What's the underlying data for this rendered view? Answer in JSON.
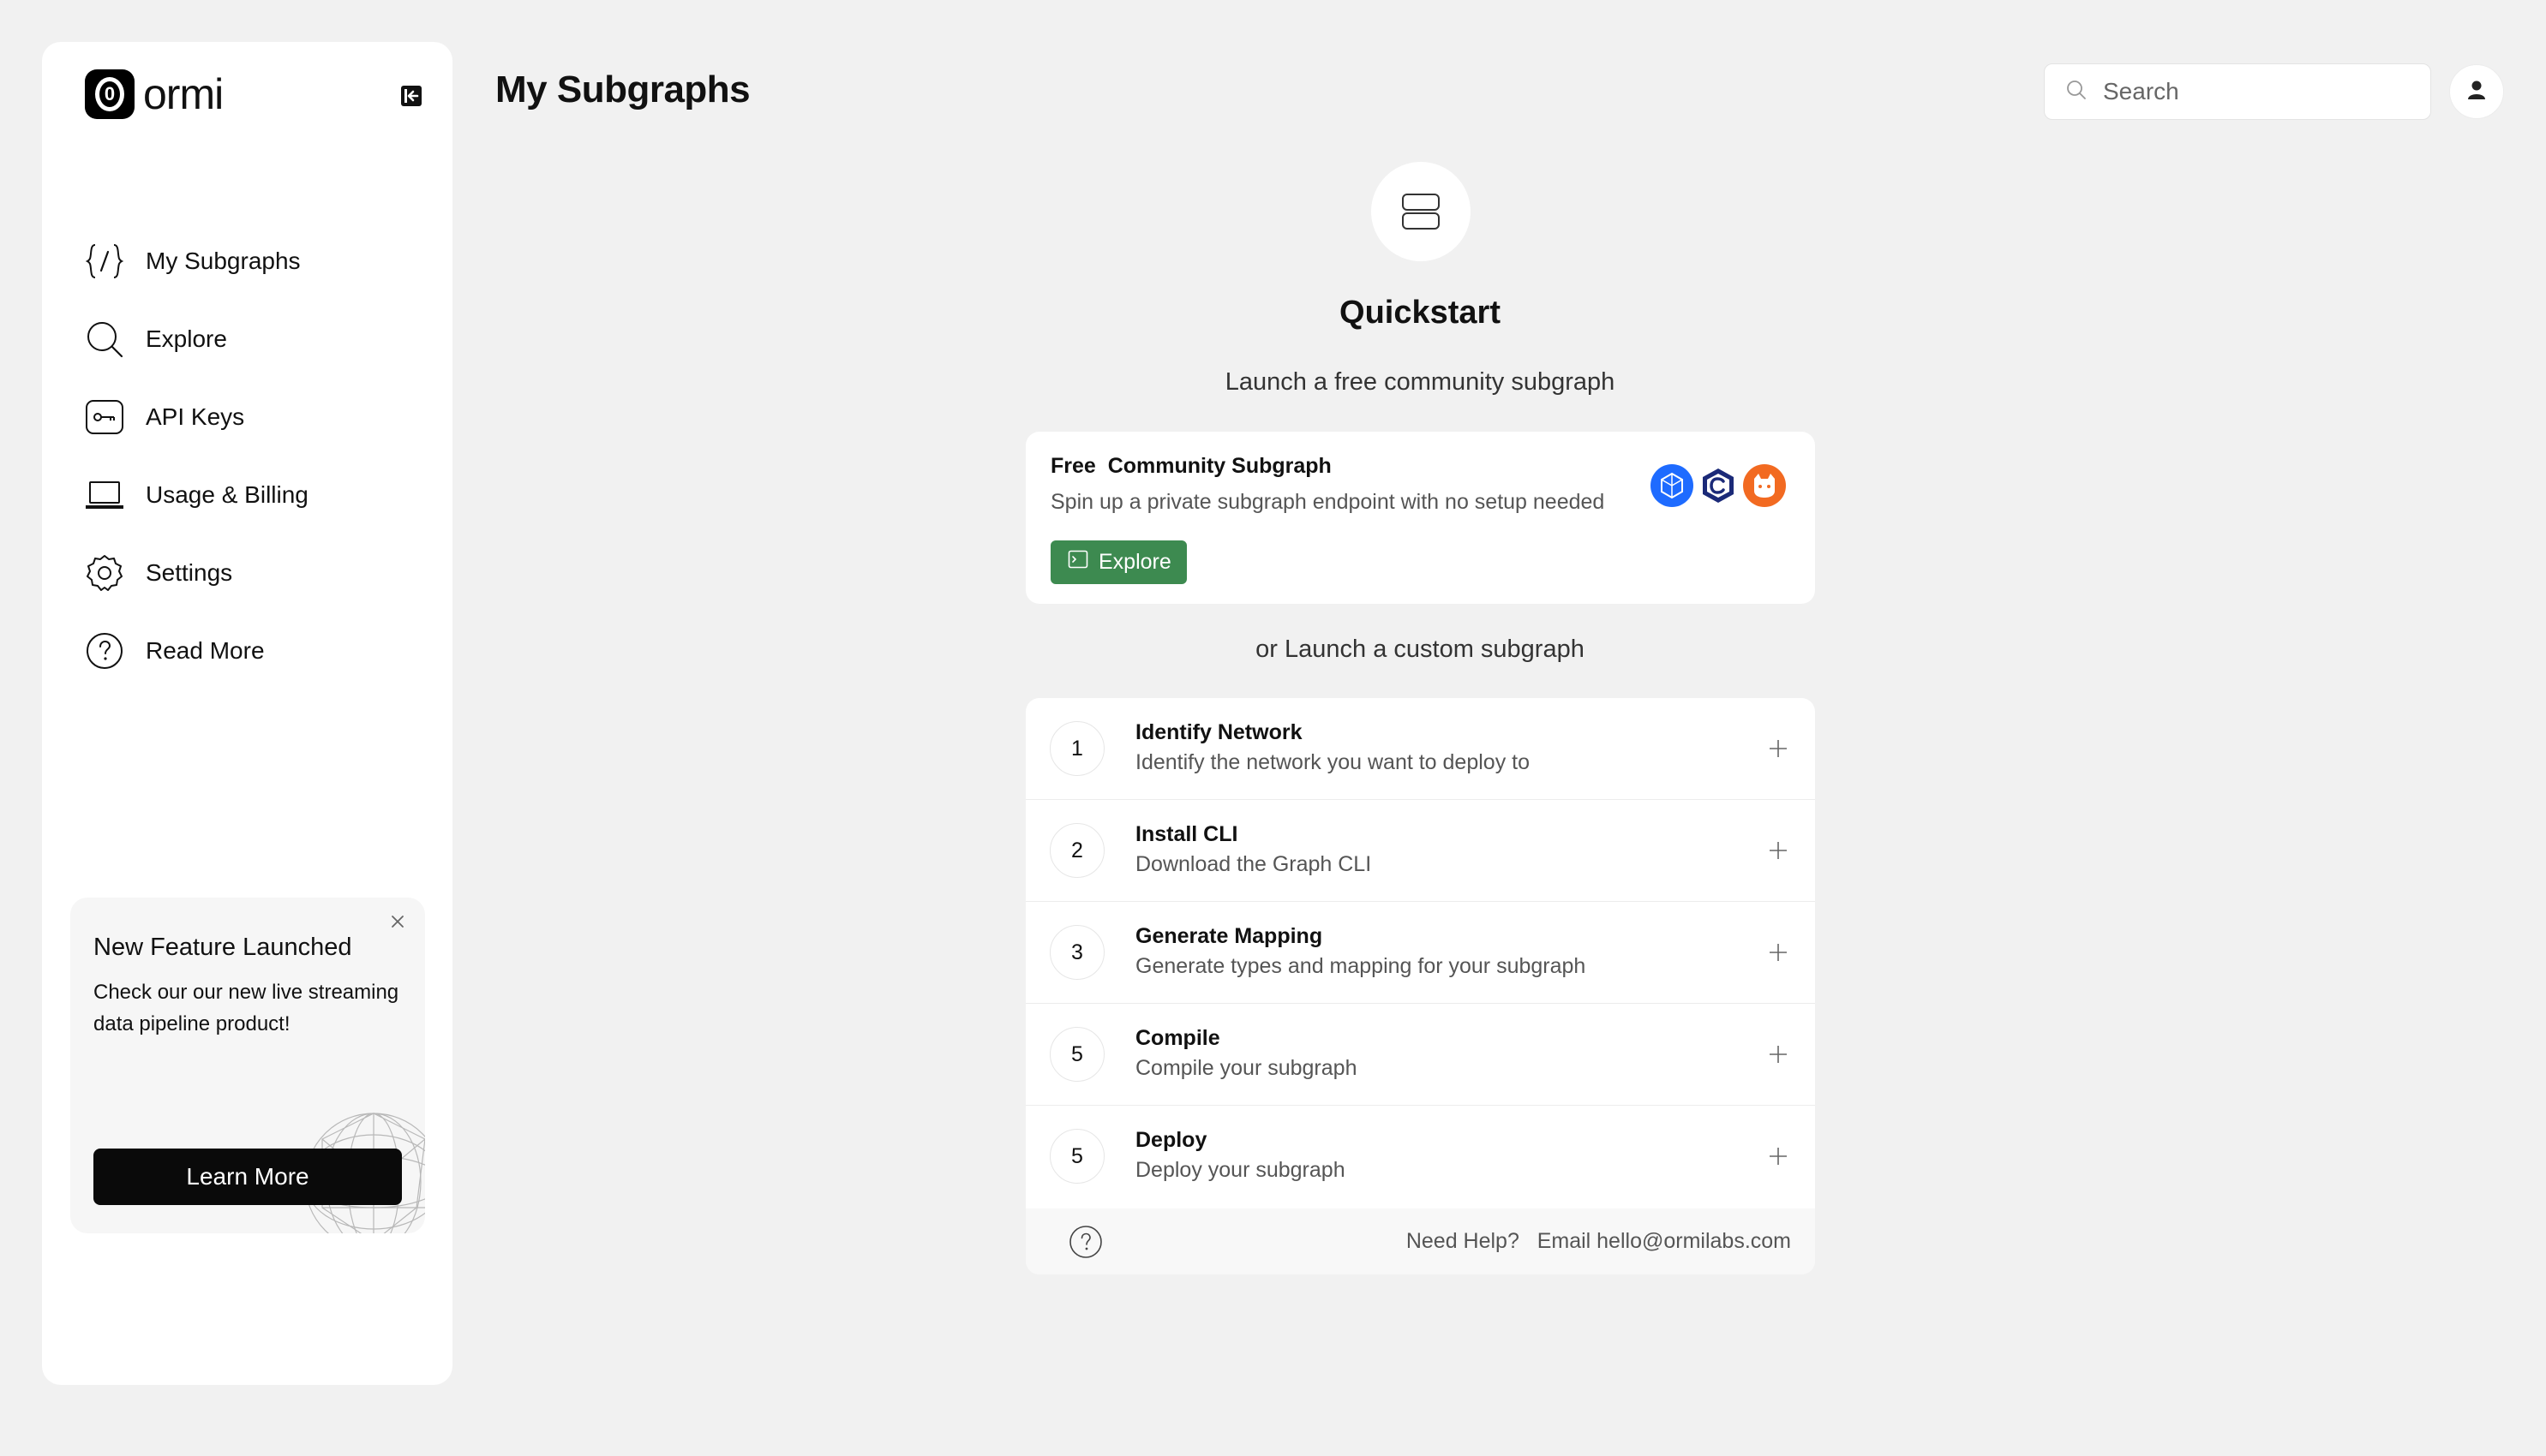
{
  "app": {
    "logo_text": "ormi",
    "logo_mark": "0",
    "page_title": "My Subgraphs"
  },
  "sidebar": {
    "items": [
      {
        "label": "My Subgraphs",
        "icon": "code-braces-icon"
      },
      {
        "label": "Explore",
        "icon": "search-icon"
      },
      {
        "label": "API Keys",
        "icon": "key-icon"
      },
      {
        "label": "Usage & Billing",
        "icon": "laptop-icon"
      },
      {
        "label": "Settings",
        "icon": "gear-icon"
      },
      {
        "label": "Read More",
        "icon": "help-icon"
      }
    ],
    "promo": {
      "title": "New Feature Launched",
      "text": "Check our our new live streaming data pipeline product!",
      "button": "Learn More"
    }
  },
  "header": {
    "search_placeholder": "Search"
  },
  "quickstart": {
    "title": "Quickstart",
    "subtitle": "Launch a free community subgraph",
    "free_card": {
      "title": "Free  Community Subgraph",
      "description": "Spin up a private subgraph endpoint with no setup needed",
      "button": "Explore",
      "chain_logos": [
        "blue-hexagon-logo",
        "navy-c-logo",
        "orange-cat-logo"
      ]
    },
    "or_text": "or Launch a custom subgraph",
    "steps": [
      {
        "num": "1",
        "title": "Identify Network",
        "desc": "Identify the network you want to deploy to"
      },
      {
        "num": "2",
        "title": "Install CLI",
        "desc": "Download the Graph CLI"
      },
      {
        "num": "3",
        "title": "Generate Mapping",
        "desc": "Generate types and mapping for your subgraph"
      },
      {
        "num": "5",
        "title": "Compile",
        "desc": "Compile your subgraph"
      },
      {
        "num": "5",
        "title": "Deploy",
        "desc": "Deploy your subgraph"
      }
    ],
    "help": {
      "text": "Need Help?   Email hello@ormilabs.com"
    }
  },
  "colors": {
    "background": "#f1f1f1",
    "explore_green": "#3d8a50",
    "learn_more_black": "#0a0a0a"
  }
}
